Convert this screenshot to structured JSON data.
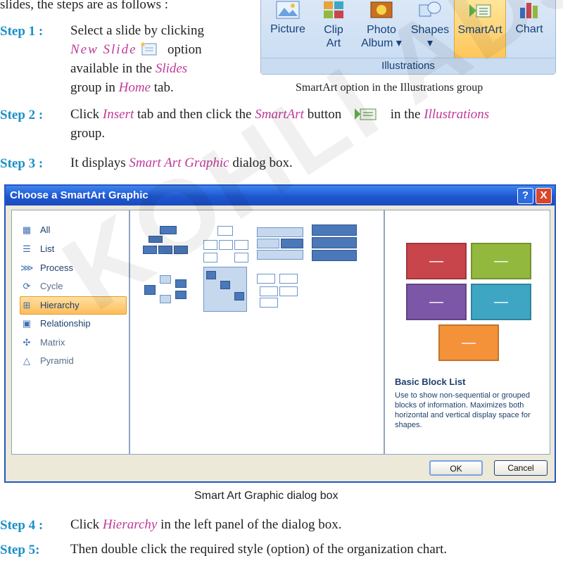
{
  "intro": "slides, the steps are as follows :",
  "ribbon": {
    "buttons": [
      "Picture",
      "Clip\nArt",
      "Photo\nAlbum ▾",
      "Shapes\n▾",
      "SmartArt",
      "Chart"
    ],
    "group_label": "Illustrations",
    "caption": "SmartArt option in the Illustrations group"
  },
  "steps": {
    "s1": {
      "label": "Step 1 :",
      "p1": "Select a slide by clicking",
      "em1": "New Slide",
      "p2": "option",
      "p3": "available in the",
      "em2": "Slides",
      "p4": "group in",
      "em3": "Home",
      "p5": "tab."
    },
    "s2": {
      "label": "Step 2 :",
      "p1": "Click",
      "em1": "Insert",
      "p2": "tab and then click the",
      "em2": "SmartArt",
      "p3": "button",
      "p4": "in the",
      "em3": "Illustrations",
      "p5": "group."
    },
    "s3": {
      "label": "Step 3 :",
      "p1": "It displays",
      "em1": "Smart Art Graphic",
      "p2": "dialog box."
    },
    "s4": {
      "label": "Step 4 :",
      "p1": "Click",
      "em1": "Hierarchy",
      "p2": "in the left panel of the dialog box."
    },
    "s5": {
      "label": "Step 5:",
      "p1": "Then double click the required style (option) of the organization chart."
    }
  },
  "dialog": {
    "title": "Choose a SmartArt Graphic",
    "help": "?",
    "close": "X",
    "categories": [
      "All",
      "List",
      "Process",
      "Cycle",
      "Hierarchy",
      "Relationship",
      "Matrix",
      "Pyramid"
    ],
    "selected_category": "Hierarchy",
    "block_glyph": "—",
    "preview_title": "Basic Block List",
    "preview_desc": "Use to show non-sequential or grouped blocks of information. Maximizes both horizontal and vertical display space for shapes.",
    "ok": "OK",
    "cancel": "Cancel",
    "block_colors": [
      "#c8454b",
      "#93b83e",
      "#7c56a7",
      "#3ea6c3",
      "#f4923a"
    ]
  },
  "dialog_caption": "Smart Art Graphic dialog box",
  "watermark": "KOHLI ADS."
}
